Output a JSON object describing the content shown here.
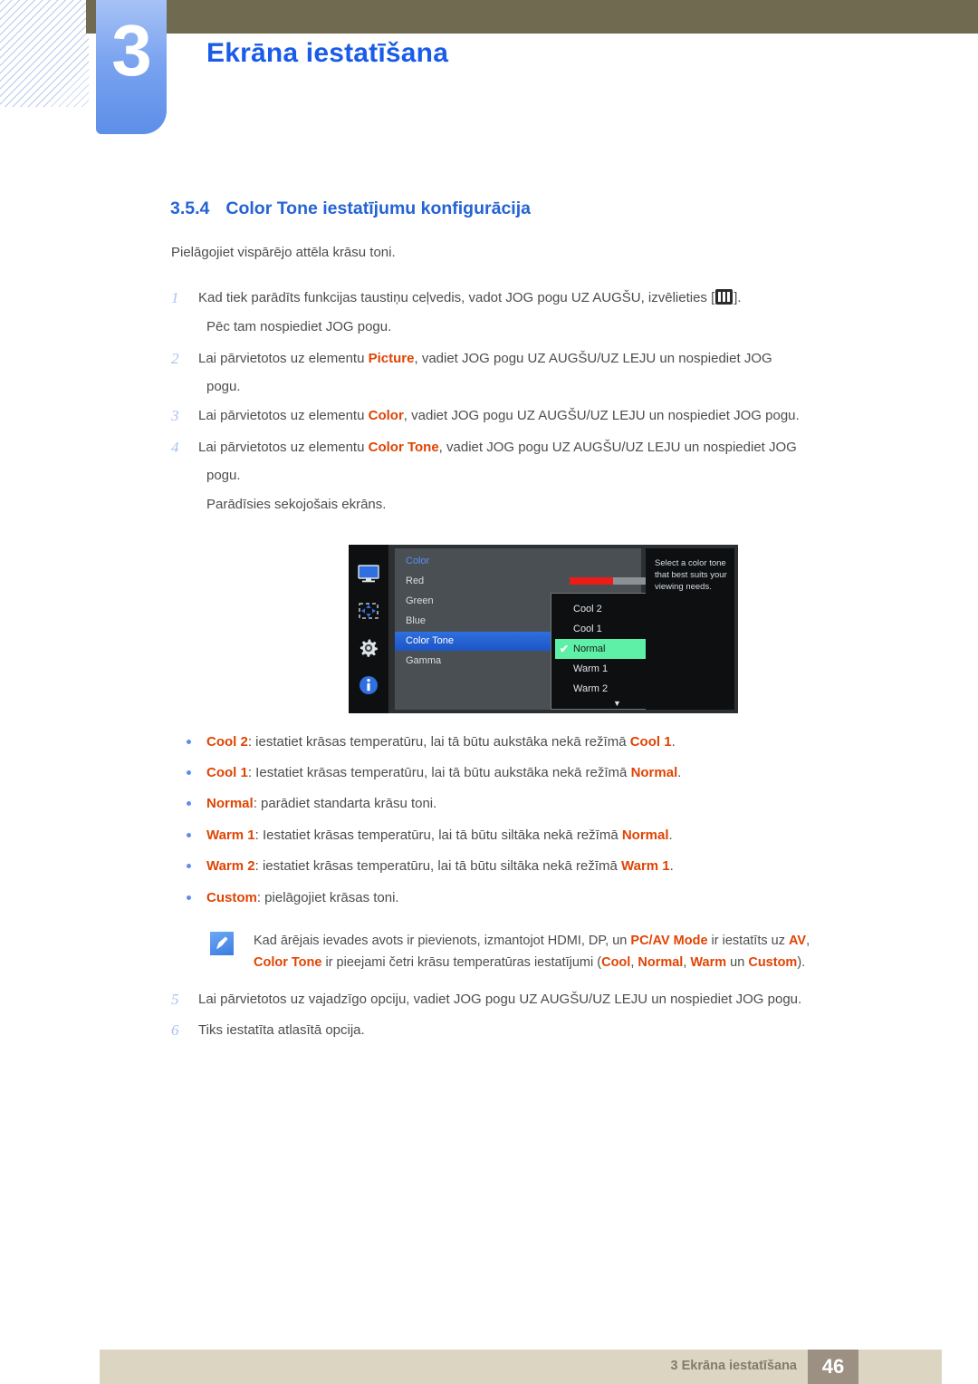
{
  "header": {
    "chapter_number": "3",
    "chapter_title": "Ekrāna iestatīšana"
  },
  "section": {
    "number": "3.5.4",
    "title": "Color Tone iestatījumu konfigurācija",
    "intro": "Pielāgojiet vispārējo attēla krāsu toni."
  },
  "steps": [
    {
      "num": "1",
      "text_before": "Kad tiek parādīts funkcijas taustiņu ceļvedis, vadot JOG pogu UZ AUGŠU, izvēlieties [",
      "icon": "menu-bars-icon",
      "text_after": "].",
      "continuation": "Pēc tam nospiediet JOG pogu."
    },
    {
      "num": "2",
      "text_before": "Lai pārvietotos uz elementu ",
      "keyword": "Picture",
      "text_after": ", vadiet JOG pogu UZ AUGŠU/UZ LEJU un nospiediet JOG",
      "continuation": "pogu."
    },
    {
      "num": "3",
      "text_before": "Lai pārvietotos uz elementu ",
      "keyword": "Color",
      "text_after": ", vadiet JOG pogu UZ AUGŠU/UZ LEJU un nospiediet JOG pogu.",
      "continuation": ""
    },
    {
      "num": "4",
      "text_before": "Lai pārvietotos uz elementu ",
      "keyword": "Color Tone",
      "text_after": ", vadiet JOG pogu UZ AUGŠU/UZ LEJU un nospiediet JOG",
      "continuation": "pogu.",
      "continuation2": "Parādīsies sekojošais ekrāns."
    },
    {
      "num": "5",
      "text_before": "Lai pārvietotos uz vajadzīgo opciju, vadiet JOG pogu UZ AUGŠU/UZ LEJU un nospiediet JOG pogu.",
      "keyword": "",
      "text_after": "",
      "continuation": ""
    },
    {
      "num": "6",
      "text_before": "Tiks iestatīta atlasītā opcija.",
      "keyword": "",
      "text_after": "",
      "continuation": ""
    }
  ],
  "osd": {
    "menu_title": "Color",
    "items": [
      {
        "label": "Red",
        "selected": false
      },
      {
        "label": "Green",
        "selected": false
      },
      {
        "label": "Blue",
        "selected": false
      },
      {
        "label": "Color Tone",
        "selected": true
      },
      {
        "label": "Gamma",
        "selected": false
      }
    ],
    "slider": {
      "value": "50",
      "fill_percent": 50,
      "fill_color": "#ed1c16",
      "track_color": "#8b9296"
    },
    "dropdown": {
      "options": [
        {
          "label": "Cool 2",
          "active": false
        },
        {
          "label": "Cool 1",
          "active": false
        },
        {
          "label": "Normal",
          "active": true
        },
        {
          "label": "Warm 1",
          "active": false
        },
        {
          "label": "Warm 2",
          "active": false
        }
      ],
      "scroll_arrow": "▼",
      "check_glyph": "✔",
      "active_color": "#5ff0a8"
    },
    "help_text": "Select a color tone that best suits your viewing needs.",
    "sidebar_icons": [
      "monitor-icon",
      "position-arrows-icon",
      "gear-icon",
      "info-icon"
    ],
    "highlight_color": "#2f6fe0"
  },
  "bullets": [
    {
      "term": "Cool 2",
      "mid": ": iestatiet krāsas temperatūru, lai tā būtu aukstāka nekā režīmā ",
      "term2": "Cool 1",
      "end": "."
    },
    {
      "term": "Cool 1",
      "mid": ": Iestatiet krāsas temperatūru, lai tā būtu aukstāka nekā režīmā ",
      "term2": "Normal",
      "end": "."
    },
    {
      "term": "Normal",
      "mid": ": parādiet standarta krāsu toni.",
      "term2": "",
      "end": ""
    },
    {
      "term": "Warm 1",
      "mid": ": Iestatiet krāsas temperatūru, lai tā būtu siltāka nekā režīmā ",
      "term2": "Normal",
      "end": "."
    },
    {
      "term": "Warm 2",
      "mid": ": iestatiet krāsas temperatūru, lai tā būtu siltāka nekā režīmā ",
      "term2": "Warm 1",
      "end": "."
    },
    {
      "term": "Custom",
      "mid": ": pielāgojiet krāsas toni.",
      "term2": "",
      "end": ""
    }
  ],
  "note": {
    "icon": "pencil-note-icon",
    "line1_a": "Kad ārējais ievades avots ir pievienots, izmantojot HDMI, DP, un ",
    "line1_kw": "PC/AV Mode",
    "line1_b": " ir iestatīts uz ",
    "line1_kw2": "AV",
    "line1_c": ",",
    "line2_kw": "Color Tone",
    "line2_a": " ir pieejami četri krāsu temperatūras iestatījumi (",
    "line2_kw2": "Cool",
    "line2_b": ", ",
    "line2_kw3": "Normal",
    "line2_c": ", ",
    "line2_kw4": "Warm",
    "line2_d": " un ",
    "line2_kw5": "Custom",
    "line2_e": ")."
  },
  "footer": {
    "text": "3 Ekrāna iestatīšana",
    "page": "46"
  },
  "colors": {
    "accent_blue": "#2563d4",
    "keyword_orange": "#e04403",
    "olive": "#706a51",
    "footer_beige": "#dcd5c2",
    "footer_page_box": "#9c9083"
  }
}
